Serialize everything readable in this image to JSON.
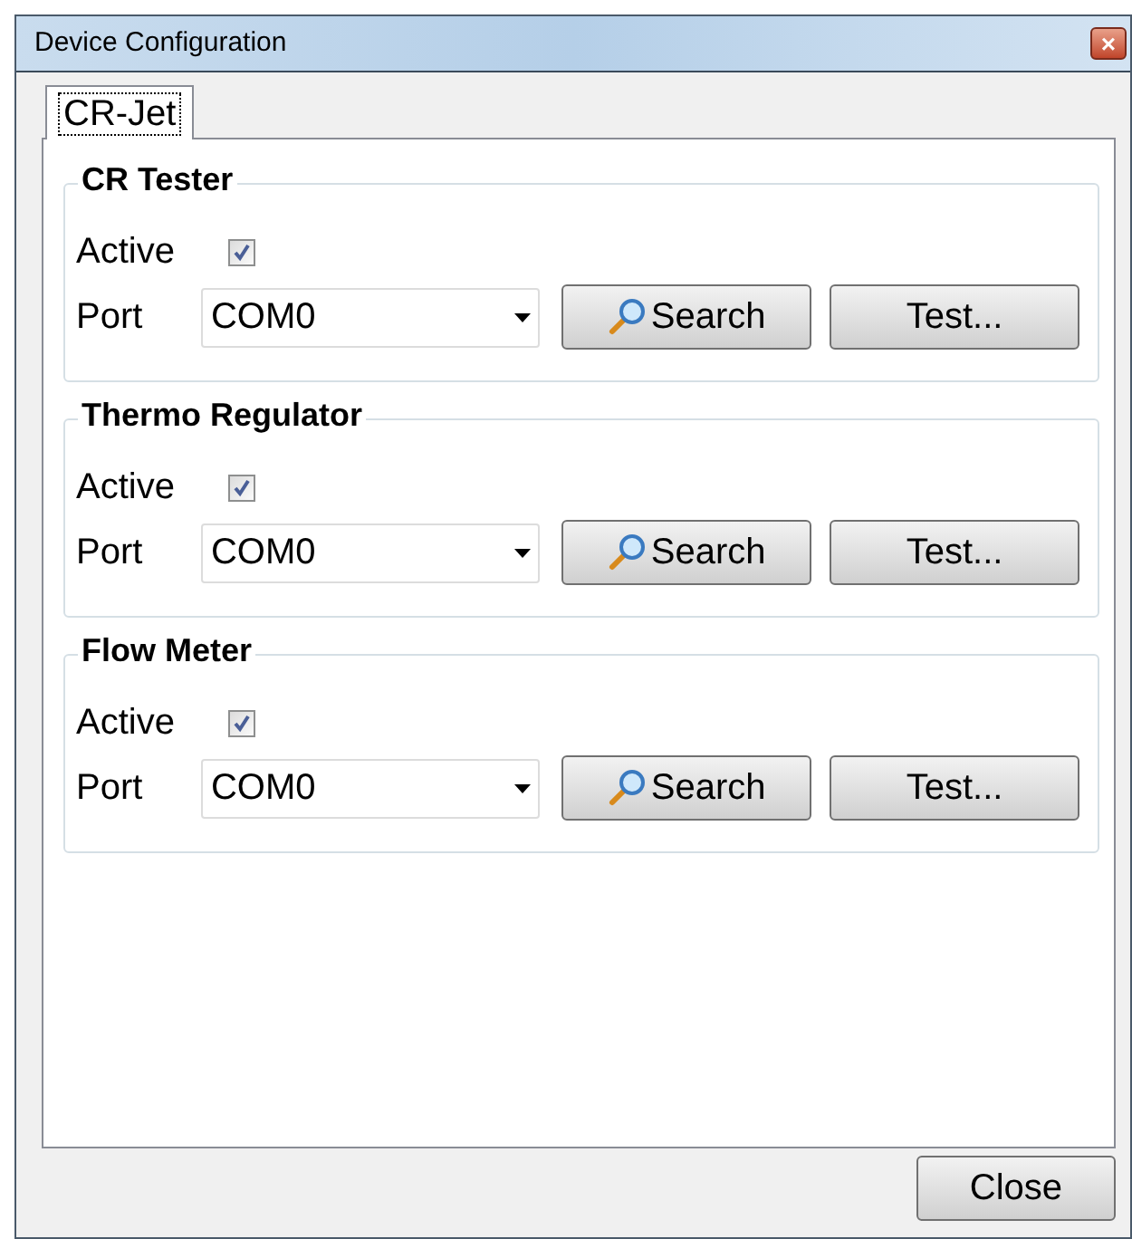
{
  "window": {
    "title": "Device Configuration",
    "close_glyph": "×"
  },
  "tabs": [
    {
      "label": "CR-Jet",
      "selected": true
    }
  ],
  "groups": [
    {
      "title": "CR Tester",
      "active_label": "Active",
      "active": true,
      "port_label": "Port",
      "port": "COM0",
      "search": "Search",
      "test": "Test..."
    },
    {
      "title": "Thermo Regulator",
      "active_label": "Active",
      "active": true,
      "port_label": "Port",
      "port": "COM0",
      "search": "Search",
      "test": "Test..."
    },
    {
      "title": "Flow Meter",
      "active_label": "Active",
      "active": true,
      "port_label": "Port",
      "port": "COM0",
      "search": "Search",
      "test": "Test..."
    }
  ],
  "close_button": "Close"
}
